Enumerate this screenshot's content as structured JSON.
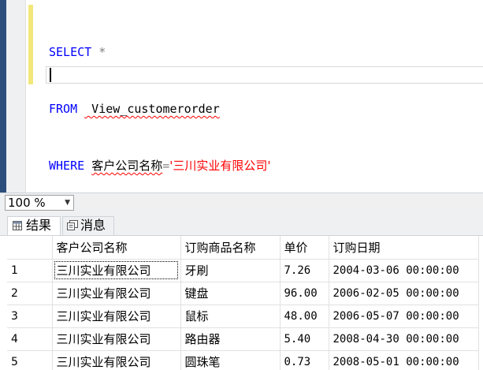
{
  "editor": {
    "lines": [
      {
        "kw": "SELECT",
        "rest": " *"
      },
      {
        "kw": "FROM",
        "rest": " View_customerorder"
      },
      {
        "kw": "WHERE",
        "col": "客户公司名称",
        "op": "=",
        "str": "'三川实业有限公司'"
      }
    ]
  },
  "status": {
    "zoom": "100 %",
    "zoom_arrow_icon": "chevron-down-icon"
  },
  "tabs": [
    {
      "label": "结果",
      "icon": "grid-icon",
      "active": true
    },
    {
      "label": "消息",
      "icon": "message-icon",
      "active": false
    }
  ],
  "results": {
    "columns": [
      "",
      "客户公司名称",
      "订购商品名称",
      "单价",
      "订购日期"
    ],
    "rows": [
      [
        "1",
        "三川实业有限公司",
        "牙刷",
        "7.26",
        "2004-03-06 00:00:00"
      ],
      [
        "2",
        "三川实业有限公司",
        "键盘",
        "96.00",
        "2006-02-05 00:00:00"
      ],
      [
        "3",
        "三川实业有限公司",
        "鼠标",
        "48.00",
        "2006-05-07 00:00:00"
      ],
      [
        "4",
        "三川实业有限公司",
        "路由器",
        "5.40",
        "2008-04-30 00:00:00"
      ],
      [
        "5",
        "三川实业有限公司",
        "圆珠笔",
        "0.73",
        "2008-05-01 00:00:00"
      ]
    ]
  },
  "colors": {
    "keyword": "#0000ff",
    "string": "#ff0000",
    "operator": "#808080",
    "rail": "#2b4e7d",
    "change_bar": "#f3e77c"
  }
}
